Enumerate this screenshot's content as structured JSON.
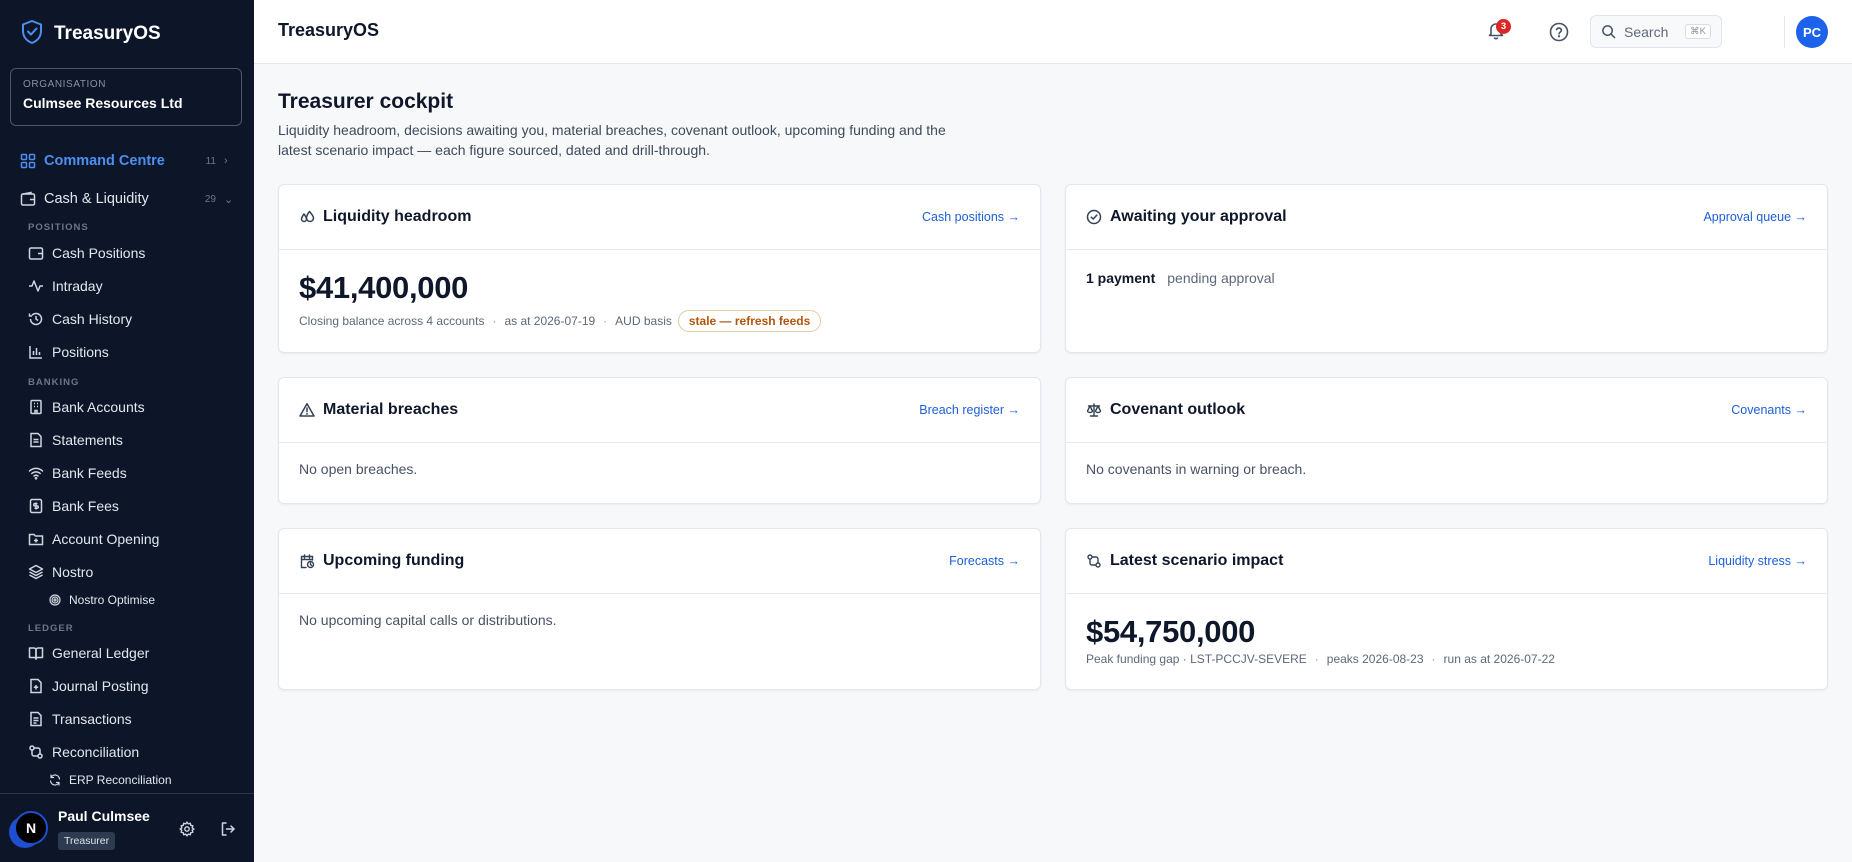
{
  "brand": {
    "name": "TreasuryOS"
  },
  "org": {
    "label": "ORGANISATION",
    "name": "Culmsee Resources Ltd"
  },
  "nav": {
    "command_centre": {
      "label": "Command Centre",
      "count": "11"
    },
    "cash_liquidity": {
      "label": "Cash & Liquidity",
      "count": "29"
    },
    "sections": {
      "positions": "POSITIONS",
      "banking": "BANKING",
      "ledger": "LEDGER"
    },
    "items": {
      "cash_positions": "Cash Positions",
      "intraday": "Intraday",
      "cash_history": "Cash History",
      "positions": "Positions",
      "bank_accounts": "Bank Accounts",
      "statements": "Statements",
      "bank_feeds": "Bank Feeds",
      "bank_fees": "Bank Fees",
      "account_opening": "Account Opening",
      "nostro": "Nostro",
      "nostro_optimise": "Nostro Optimise",
      "general_ledger": "General Ledger",
      "journal_posting": "Journal Posting",
      "transactions": "Transactions",
      "reconciliation": "Reconciliation",
      "erp_reconciliation": "ERP Reconciliation"
    }
  },
  "user": {
    "initial": "N",
    "name": "Paul Culmsee",
    "role": "Treasurer"
  },
  "header": {
    "title": "TreasuryOS",
    "search_label": "Search",
    "search_shortcut": "⌘K",
    "notification_count": "3",
    "avatar_initials": "PC"
  },
  "page": {
    "title": "Treasurer cockpit",
    "subtitle": "Liquidity headroom, decisions awaiting you, material breaches, covenant outlook, upcoming funding and the latest scenario impact — each figure sourced, dated and drill-through."
  },
  "cards": {
    "liquidity": {
      "title": "Liquidity headroom",
      "link": "Cash positions →",
      "value": "$41,400,000",
      "meta1": "Closing balance across 4 accounts",
      "meta2": "as at 2026-07-19",
      "meta3": "AUD basis",
      "chip": "stale — refresh feeds"
    },
    "approval": {
      "title": "Awaiting your approval",
      "link": "Approval queue →",
      "count": "1 payment",
      "status": "pending approval"
    },
    "breaches": {
      "title": "Material breaches",
      "link": "Breach register →",
      "empty": "No open breaches."
    },
    "covenant": {
      "title": "Covenant outlook",
      "link": "Covenants →",
      "empty": "No covenants in warning or breach."
    },
    "funding": {
      "title": "Upcoming funding",
      "link": "Forecasts →",
      "empty": "No upcoming capital calls or distributions."
    },
    "scenario": {
      "title": "Latest scenario impact",
      "link": "Liquidity stress →",
      "value": "$54,750,000",
      "meta1": "Peak funding gap · LST-PCCJV-SEVERE",
      "meta2": "peaks 2026-08-23",
      "meta3": "run as at 2026-07-22"
    }
  },
  "colors": {
    "sidebar_bg": "#0d1628",
    "accent": "#1d5fd8",
    "active_nav": "#4d8ff0",
    "stale": "#b4540a",
    "badge": "#dc2626"
  }
}
